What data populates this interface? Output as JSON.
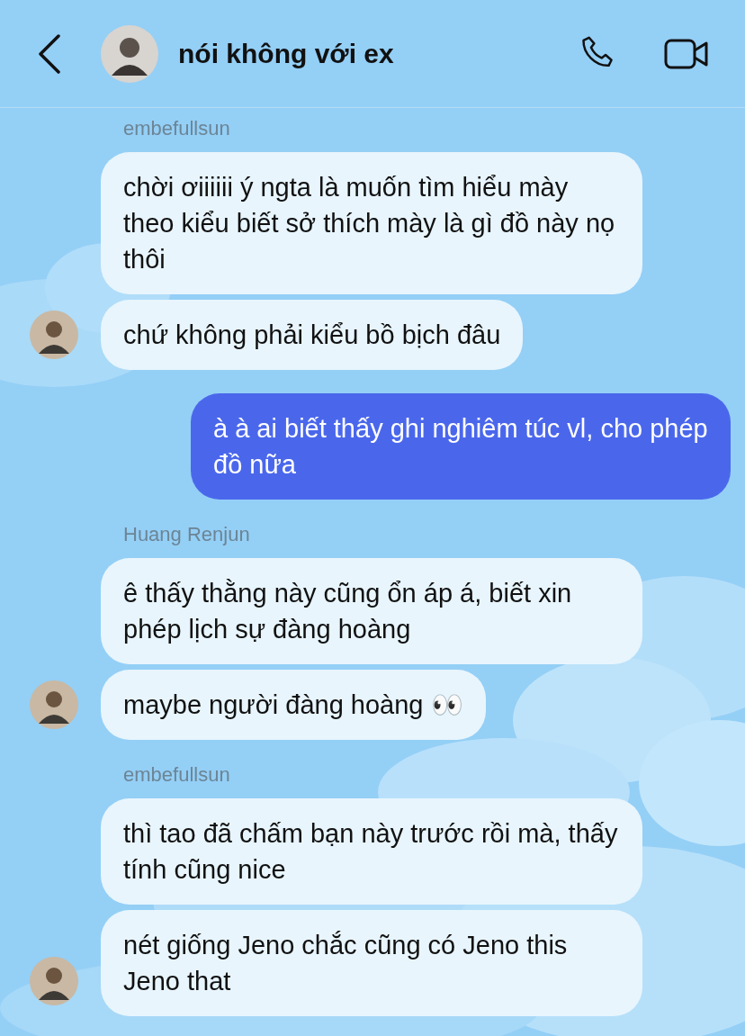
{
  "header": {
    "title": "nói không với ex"
  },
  "groups": [
    {
      "kind": "incoming",
      "sender": "embefullsun",
      "bubbles": [
        "chời ơiiiiii ý ngta là muốn tìm hiểu mày theo kiểu biết sở thích mày là gì đồ này nọ thôi",
        "chứ không phải kiểu bồ bịch đâu"
      ]
    },
    {
      "kind": "outgoing",
      "bubbles": [
        "à à ai biết thấy ghi nghiêm túc vl, cho phép đồ nữa"
      ]
    },
    {
      "kind": "incoming",
      "sender": "Huang Renjun",
      "bubbles": [
        "ê thấy thằng này cũng ổn áp á, biết xin phép lịch sự đàng hoàng",
        "maybe người đàng hoàng 👀"
      ]
    },
    {
      "kind": "incoming",
      "sender": "embefullsun",
      "bubbles": [
        "thì tao đã chấm bạn này trước rồi mà, thấy tính cũng nice",
        "nét giống Jeno chắc cũng có Jeno this Jeno that"
      ]
    }
  ]
}
